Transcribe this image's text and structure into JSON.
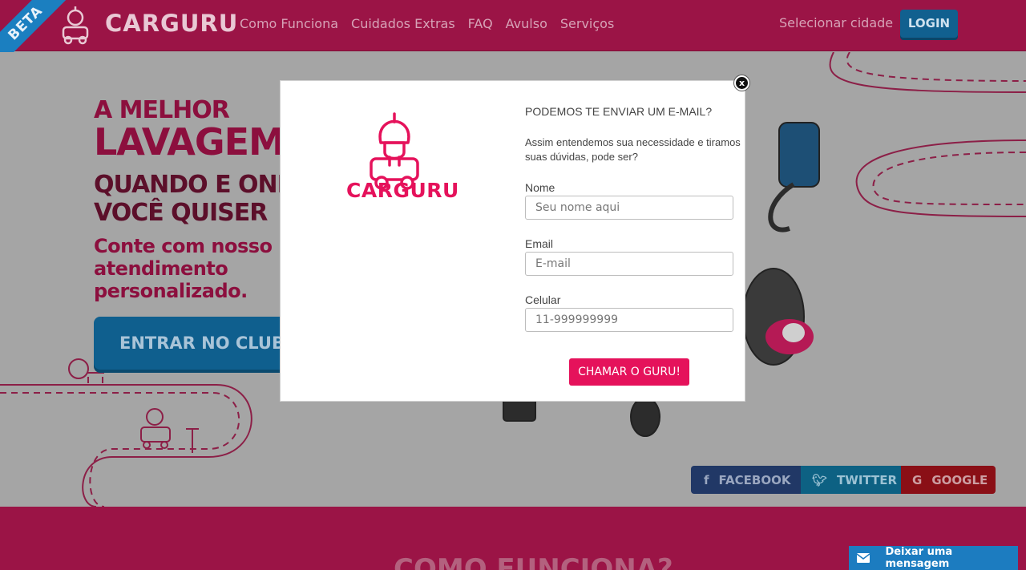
{
  "header": {
    "beta": "BETA",
    "brand": "CARGURU",
    "nav": [
      "Como Funciona",
      "Cuidados Extras",
      "FAQ",
      "Avulso",
      "Serviços"
    ],
    "city": "Selecionar cidade",
    "login": "LOGIN"
  },
  "hero": {
    "line1": "A MELHOR",
    "line2": "LAVAGEM",
    "line3": "QUANDO E ONDE",
    "line4": "VOCÊ QUISER",
    "sub1": "Conte com nosso",
    "sub2": "atendimento",
    "sub3": "personalizado.",
    "cta": "ENTRAR NO CLUBE"
  },
  "social": {
    "facebook": "FACEBOOK",
    "twitter": "TWITTER",
    "google": "GOOGLE"
  },
  "band": {
    "title": "COMO FUNCIONA?"
  },
  "message_tab": {
    "label": "Deixar uma mensagem"
  },
  "modal": {
    "logo_text": "CARGURU",
    "title": "PODEMOS TE ENVIAR UM E-MAIL?",
    "description": "Assim entendemos sua necessidade e tiramos suas dúvidas, pode ser?",
    "fields": {
      "name_label": "Nome",
      "name_placeholder": "Seu nome aqui",
      "email_label": "Email",
      "email_placeholder": "E-mail",
      "phone_label": "Celular",
      "phone_placeholder": "11-999999999"
    },
    "submit": "CHAMAR O GURU!",
    "close": "x"
  },
  "colors": {
    "brand": "#e5125b",
    "header_bg": "#9b1446",
    "accent_blue": "#1c7cc0",
    "overlay": "#a5a5a5"
  },
  "icons": [
    "guru-logo-icon",
    "facebook-icon",
    "twitter-icon",
    "google-icon",
    "envelope-icon",
    "close-icon"
  ]
}
